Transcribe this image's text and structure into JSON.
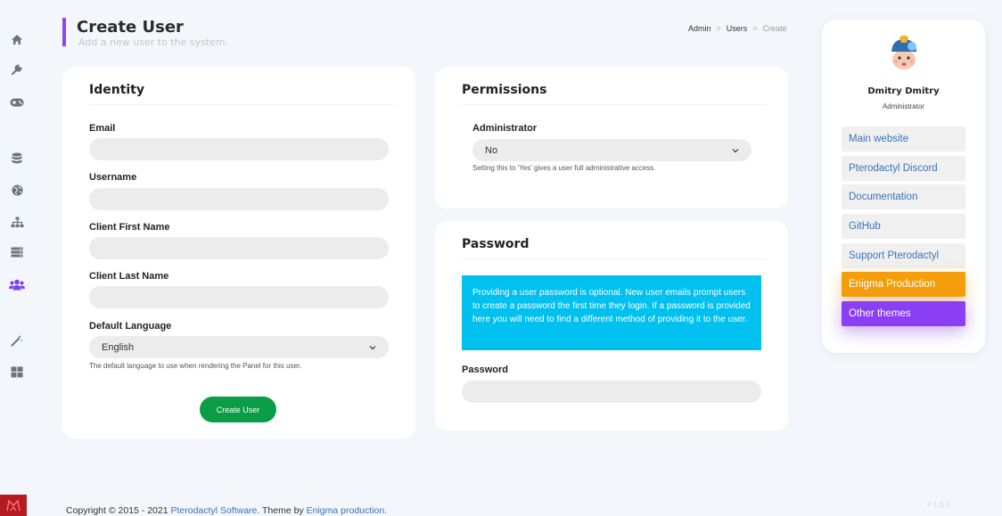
{
  "header": {
    "title": "Create User",
    "subtitle": "Add a new user to the system.",
    "breadcrumb": [
      "Admin",
      "Users",
      "Create"
    ]
  },
  "sidebar_icons": [
    "home-icon",
    "wrench-icon",
    "gamepad-icon",
    "database-icon",
    "globe-icon",
    "sitemap-icon",
    "server-icon",
    "users-icon",
    "magic-wand-icon",
    "grid-icon"
  ],
  "identity": {
    "title": "Identity",
    "email_label": "Email",
    "username_label": "Username",
    "first_name_label": "Client First Name",
    "last_name_label": "Client Last Name",
    "language_label": "Default Language",
    "language_value": "English",
    "language_help": "The default language to use when rendering the Panel for this user.",
    "create_button": "Create User"
  },
  "permissions": {
    "title": "Permissions",
    "admin_label": "Administrator",
    "admin_value": "No",
    "admin_help": "Setting this to 'Yes' gives a user full administrative access."
  },
  "password": {
    "title": "Password",
    "info": "Providing a user password is optional. New user emails prompt users to create a password the first time they login. If a password is provided here you will need to find a different method of providing it to the user.",
    "label": "Password"
  },
  "profile": {
    "name": "Dmitry Dmitry",
    "role": "Administrator",
    "links": [
      "Main website",
      "Pterodactyl Discord",
      "Documentation",
      "GitHub",
      "Support Pterodactyl",
      "Enigma Production",
      "Other themes"
    ]
  },
  "footer": {
    "prefix": "Copyright © 2015 - 2021 ",
    "software": "Pterodactyl Software.",
    "theme_by": " Theme by ",
    "theme": "Enigma production.",
    "version": "P  1.6.5"
  },
  "colors": {
    "accent": "#8e44ff",
    "primary_button": "#0a9c47",
    "info": "#00c0ef",
    "link": "#3b73b9",
    "orange": "#f59e0b",
    "purple": "#8b3ff5",
    "active_icon": "#7b3ff2",
    "icon": "#6b7480"
  }
}
